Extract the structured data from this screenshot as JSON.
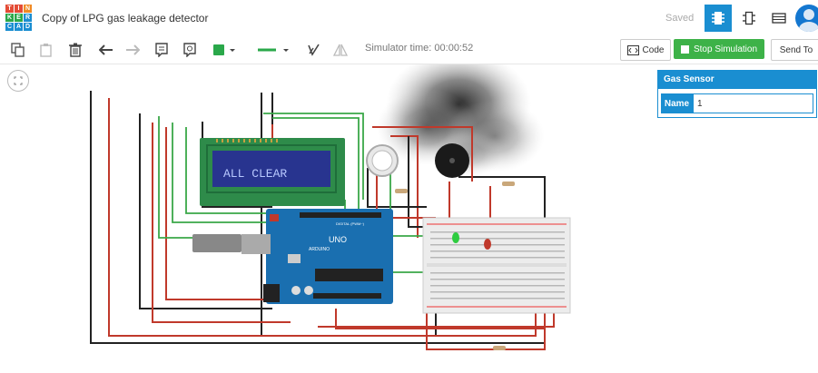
{
  "app": {
    "logo_letters": [
      "T",
      "I",
      "N",
      "K",
      "E",
      "R",
      "C",
      "A",
      "D"
    ],
    "title": "Copy of LPG gas leakage detector",
    "save_status": "Saved"
  },
  "views": [
    "circuit-view",
    "schematic-view",
    "component-list-view"
  ],
  "toolbar": {
    "simulator_time": "Simulator time: 00:00:52",
    "code_label": "Code",
    "stop_label": "Stop Simulation",
    "send_label": "Send To"
  },
  "inspector": {
    "header": "Gas Sensor",
    "name_label": "Name",
    "name_value": "1"
  },
  "circuit": {
    "lcd_text": "ALL CLEAR",
    "arduino_label": "UNO",
    "arduino_brand": "ARDUINO",
    "arduino_header_label": "DIGITAL (PWM~)"
  },
  "colors": {
    "accent": "#1a8ed1",
    "stop": "#3db248",
    "wire_red": "#c0392b",
    "wire_black": "#222222",
    "wire_green": "#3aa848",
    "arduino": "#1a6fb0",
    "lcd_bg": "#28348f",
    "lcd_text": "#b8c8ff"
  }
}
